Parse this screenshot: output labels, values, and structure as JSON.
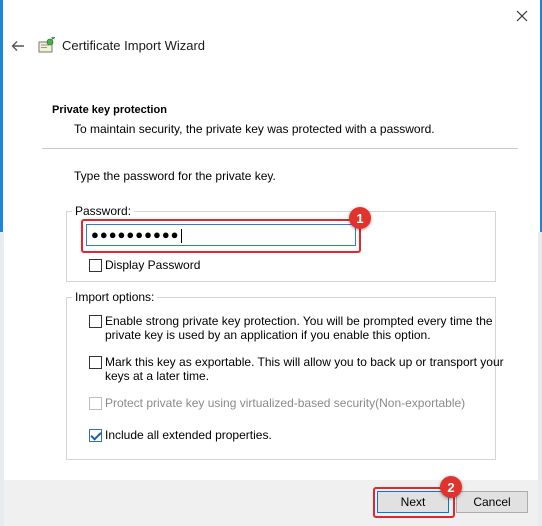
{
  "window": {
    "title": "Certificate Import Wizard",
    "accent_color": "#1e86d6"
  },
  "icons": {
    "close": "close-icon",
    "back": "back-arrow-icon",
    "wizard": "certificate-icon"
  },
  "header": {
    "title": "Private key protection",
    "description": "To maintain security, the private key was protected with a password."
  },
  "password_section": {
    "prompt": "Type the password for the private key.",
    "group_label": "Password:",
    "value": "●●●●●●●●●●",
    "display_password_label": "Display Password",
    "display_password_checked": false
  },
  "import_options": {
    "group_label": "Import options:",
    "options": [
      {
        "line1": "Enable strong private key protection. You will be prompted every time the",
        "line2": "private key is used by an application if you enable this option.",
        "checked": false,
        "enabled": true
      },
      {
        "line1": "Mark this key as exportable. This will allow you to back up or transport your",
        "line2": "keys at a later time.",
        "checked": false,
        "enabled": true
      },
      {
        "line1": "Protect private key using virtualized-based security(Non-exportable)",
        "checked": false,
        "enabled": false
      },
      {
        "line1": "Include all extended properties.",
        "checked": true,
        "enabled": true
      }
    ]
  },
  "buttons": {
    "next": "Next",
    "cancel": "Cancel"
  },
  "annotations": {
    "step1": "1",
    "step2": "2",
    "highlight_color": "#e3262f"
  }
}
